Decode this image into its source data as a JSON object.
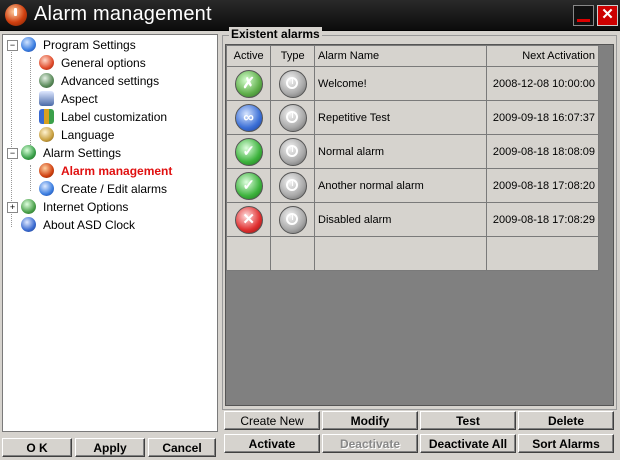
{
  "window": {
    "title": "Alarm management",
    "minimize_glyph": "_",
    "close_glyph": "✕"
  },
  "tree": {
    "items": [
      {
        "label": "Program Settings",
        "icon": "globe-icon",
        "color": "#3a7de0"
      },
      {
        "label": "General options",
        "icon": "gear-red-icon",
        "color": "#e04a2a"
      },
      {
        "label": "Advanced settings",
        "icon": "tools-icon",
        "color": "#5a8a5a"
      },
      {
        "label": "Aspect",
        "icon": "monitor-icon",
        "color": "#4a6aa8"
      },
      {
        "label": "Label customization",
        "icon": "label-icon",
        "color": "#d8a020"
      },
      {
        "label": "Language",
        "icon": "language-icon",
        "color": "#c8a040"
      },
      {
        "label": "Alarm Settings",
        "icon": "alarm-settings-icon",
        "color": "#3aa04a"
      },
      {
        "label": "Alarm management",
        "icon": "alarm-management-icon",
        "color": "#d04010"
      },
      {
        "label": "Create / Edit alarms",
        "icon": "create-alarm-icon",
        "color": "#3a7de0"
      },
      {
        "label": "Internet Options",
        "icon": "internet-icon",
        "color": "#4aa04a"
      },
      {
        "label": "About ASD Clock",
        "icon": "about-icon",
        "color": "#3a6ad0"
      }
    ]
  },
  "alarms_group": {
    "title": "Existent alarms",
    "columns": {
      "active": "Active",
      "type": "Type",
      "name": "Alarm Name",
      "next": "Next Activation"
    },
    "rows": [
      {
        "status": "welcome",
        "glyph": "✗",
        "name": "Welcome!",
        "next": "2008-12-08 10:00:00"
      },
      {
        "status": "repeat",
        "glyph": "∞",
        "name": "Repetitive Test",
        "next": "2009-09-18 16:07:37"
      },
      {
        "status": "normal",
        "glyph": "✓",
        "name": "Normal alarm",
        "next": "2009-08-18 18:08:09"
      },
      {
        "status": "normal",
        "glyph": "✓",
        "name": "Another normal alarm",
        "next": "2009-08-18 17:08:20"
      },
      {
        "status": "disabled",
        "glyph": "✕",
        "name": "Disabled alarm",
        "next": "2009-08-18 17:08:29"
      }
    ]
  },
  "actions": {
    "create_new": "Create New",
    "modify": "Modify",
    "test": "Test",
    "delete": "Delete",
    "activate": "Activate",
    "deactivate": "Deactivate",
    "deactivate_all": "Deactivate All",
    "sort_alarms": "Sort Alarms"
  },
  "dialog": {
    "ok": "O K",
    "apply": "Apply",
    "cancel": "Cancel"
  }
}
